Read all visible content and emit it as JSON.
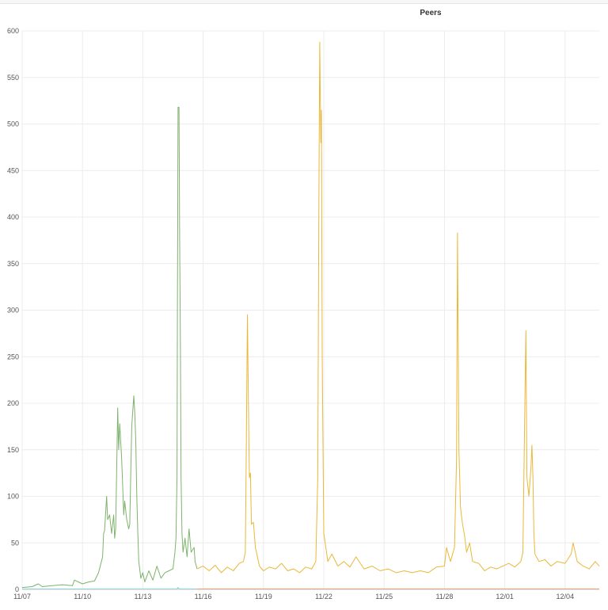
{
  "panel": {
    "title": "Peers"
  },
  "colors": {
    "series_a": "#7eb26d",
    "series_b": "#eab839",
    "series_c": "#6ed0e0",
    "series_d": "#ef843c",
    "grid": "#ececec",
    "axis": "#cfcfcf"
  },
  "chart_data": {
    "type": "line",
    "title": "Peers",
    "xlabel": "",
    "ylabel": "",
    "ylim": [
      0,
      600
    ],
    "xlim": [
      0,
      28.7
    ],
    "x_unit": "days from 11/07",
    "x_ticks": [
      {
        "x": 0,
        "label": "11/07"
      },
      {
        "x": 3,
        "label": "11/10"
      },
      {
        "x": 6,
        "label": "11/13"
      },
      {
        "x": 9,
        "label": "11/16"
      },
      {
        "x": 12,
        "label": "11/19"
      },
      {
        "x": 15,
        "label": "11/22"
      },
      {
        "x": 18,
        "label": "11/25"
      },
      {
        "x": 21,
        "label": "11/28"
      },
      {
        "x": 24,
        "label": "12/01"
      },
      {
        "x": 27,
        "label": "12/04"
      }
    ],
    "y_ticks": [
      0,
      50,
      100,
      150,
      200,
      250,
      300,
      350,
      400,
      450,
      500,
      550,
      600
    ],
    "grid": true,
    "legend": "none",
    "series": [
      {
        "values": [
          [
            0.0,
            2
          ],
          [
            0.5,
            3
          ],
          [
            0.8,
            6
          ],
          [
            1.0,
            3
          ],
          [
            1.5,
            4
          ],
          [
            2.0,
            5
          ],
          [
            2.5,
            4
          ],
          [
            2.6,
            10
          ],
          [
            3.0,
            6
          ],
          [
            3.3,
            8
          ],
          [
            3.6,
            9
          ],
          [
            3.8,
            18
          ],
          [
            4.0,
            35
          ],
          [
            4.05,
            60
          ],
          [
            4.1,
            63
          ],
          [
            4.2,
            100
          ],
          [
            4.25,
            75
          ],
          [
            4.35,
            80
          ],
          [
            4.45,
            60
          ],
          [
            4.55,
            80
          ],
          [
            4.6,
            55
          ],
          [
            4.65,
            65
          ],
          [
            4.75,
            195
          ],
          [
            4.8,
            150
          ],
          [
            4.85,
            178
          ],
          [
            4.95,
            140
          ],
          [
            5.05,
            80
          ],
          [
            5.1,
            95
          ],
          [
            5.2,
            75
          ],
          [
            5.3,
            65
          ],
          [
            5.35,
            70
          ],
          [
            5.45,
            175
          ],
          [
            5.55,
            208
          ],
          [
            5.6,
            190
          ],
          [
            5.65,
            160
          ],
          [
            5.7,
            100
          ],
          [
            5.75,
            60
          ],
          [
            5.8,
            30
          ],
          [
            5.9,
            12
          ],
          [
            6.0,
            18
          ],
          [
            6.1,
            8
          ],
          [
            6.3,
            20
          ],
          [
            6.5,
            10
          ],
          [
            6.7,
            25
          ],
          [
            6.9,
            12
          ],
          [
            7.1,
            18
          ],
          [
            7.3,
            20
          ],
          [
            7.5,
            22
          ],
          [
            7.6,
            40
          ],
          [
            7.65,
            55
          ],
          [
            7.7,
            120
          ],
          [
            7.72,
            300
          ],
          [
            7.75,
            518
          ],
          [
            7.8,
            518
          ],
          [
            7.83,
            380
          ],
          [
            7.87,
            260
          ],
          [
            7.9,
            120
          ],
          [
            7.95,
            60
          ],
          [
            8.0,
            40
          ],
          [
            8.1,
            55
          ],
          [
            8.2,
            35
          ],
          [
            8.3,
            65
          ],
          [
            8.4,
            40
          ],
          [
            8.55,
            45
          ],
          [
            8.6,
            30
          ],
          [
            8.7,
            22
          ]
        ]
      },
      {
        "values": [
          [
            8.7,
            22
          ],
          [
            9.0,
            25
          ],
          [
            9.3,
            20
          ],
          [
            9.6,
            26
          ],
          [
            9.9,
            18
          ],
          [
            10.2,
            24
          ],
          [
            10.5,
            20
          ],
          [
            10.8,
            28
          ],
          [
            11.0,
            30
          ],
          [
            11.1,
            40
          ],
          [
            11.15,
            160
          ],
          [
            11.2,
            295
          ],
          [
            11.25,
            200
          ],
          [
            11.3,
            120
          ],
          [
            11.35,
            125
          ],
          [
            11.4,
            70
          ],
          [
            11.5,
            72
          ],
          [
            11.6,
            45
          ],
          [
            11.7,
            35
          ],
          [
            11.8,
            25
          ],
          [
            12.0,
            20
          ],
          [
            12.3,
            24
          ],
          [
            12.6,
            22
          ],
          [
            12.9,
            28
          ],
          [
            13.2,
            20
          ],
          [
            13.5,
            22
          ],
          [
            13.8,
            18
          ],
          [
            14.1,
            24
          ],
          [
            14.4,
            22
          ],
          [
            14.6,
            30
          ],
          [
            14.7,
            120
          ],
          [
            14.75,
            400
          ],
          [
            14.8,
            588
          ],
          [
            14.85,
            480
          ],
          [
            14.88,
            515
          ],
          [
            14.92,
            250
          ],
          [
            15.0,
            60
          ],
          [
            15.1,
            45
          ],
          [
            15.2,
            30
          ],
          [
            15.4,
            38
          ],
          [
            15.7,
            25
          ],
          [
            16.0,
            30
          ],
          [
            16.3,
            24
          ],
          [
            16.6,
            35
          ],
          [
            17.0,
            22
          ],
          [
            17.4,
            25
          ],
          [
            17.8,
            20
          ],
          [
            18.2,
            22
          ],
          [
            18.6,
            18
          ],
          [
            19.0,
            20
          ],
          [
            19.4,
            18
          ],
          [
            19.8,
            20
          ],
          [
            20.2,
            18
          ],
          [
            20.6,
            24
          ],
          [
            21.0,
            25
          ],
          [
            21.1,
            45
          ],
          [
            21.3,
            30
          ],
          [
            21.5,
            45
          ],
          [
            21.6,
            140
          ],
          [
            21.65,
            383
          ],
          [
            21.72,
            150
          ],
          [
            21.8,
            88
          ],
          [
            21.9,
            70
          ],
          [
            22.0,
            58
          ],
          [
            22.1,
            40
          ],
          [
            22.25,
            50
          ],
          [
            22.4,
            30
          ],
          [
            22.7,
            28
          ],
          [
            23.0,
            20
          ],
          [
            23.3,
            24
          ],
          [
            23.6,
            22
          ],
          [
            23.9,
            25
          ],
          [
            24.2,
            28
          ],
          [
            24.5,
            24
          ],
          [
            24.8,
            30
          ],
          [
            24.9,
            40
          ],
          [
            25.0,
            200
          ],
          [
            25.05,
            278
          ],
          [
            25.1,
            120
          ],
          [
            25.2,
            100
          ],
          [
            25.3,
            130
          ],
          [
            25.35,
            155
          ],
          [
            25.4,
            120
          ],
          [
            25.45,
            60
          ],
          [
            25.5,
            38
          ],
          [
            25.7,
            30
          ],
          [
            26.0,
            32
          ],
          [
            26.3,
            25
          ],
          [
            26.6,
            30
          ],
          [
            27.0,
            28
          ],
          [
            27.3,
            38
          ],
          [
            27.4,
            50
          ],
          [
            27.6,
            30
          ],
          [
            27.9,
            25
          ],
          [
            28.2,
            22
          ],
          [
            28.5,
            30
          ],
          [
            28.7,
            25
          ]
        ]
      },
      {
        "values": [
          [
            0.0,
            0.5
          ],
          [
            3.0,
            0.5
          ],
          [
            7.7,
            0.5
          ],
          [
            7.75,
            2
          ],
          [
            7.8,
            0.5
          ],
          [
            8.7,
            0.5
          ]
        ]
      },
      {
        "values": [
          [
            8.7,
            0.5
          ],
          [
            28.7,
            0.5
          ]
        ]
      }
    ]
  }
}
